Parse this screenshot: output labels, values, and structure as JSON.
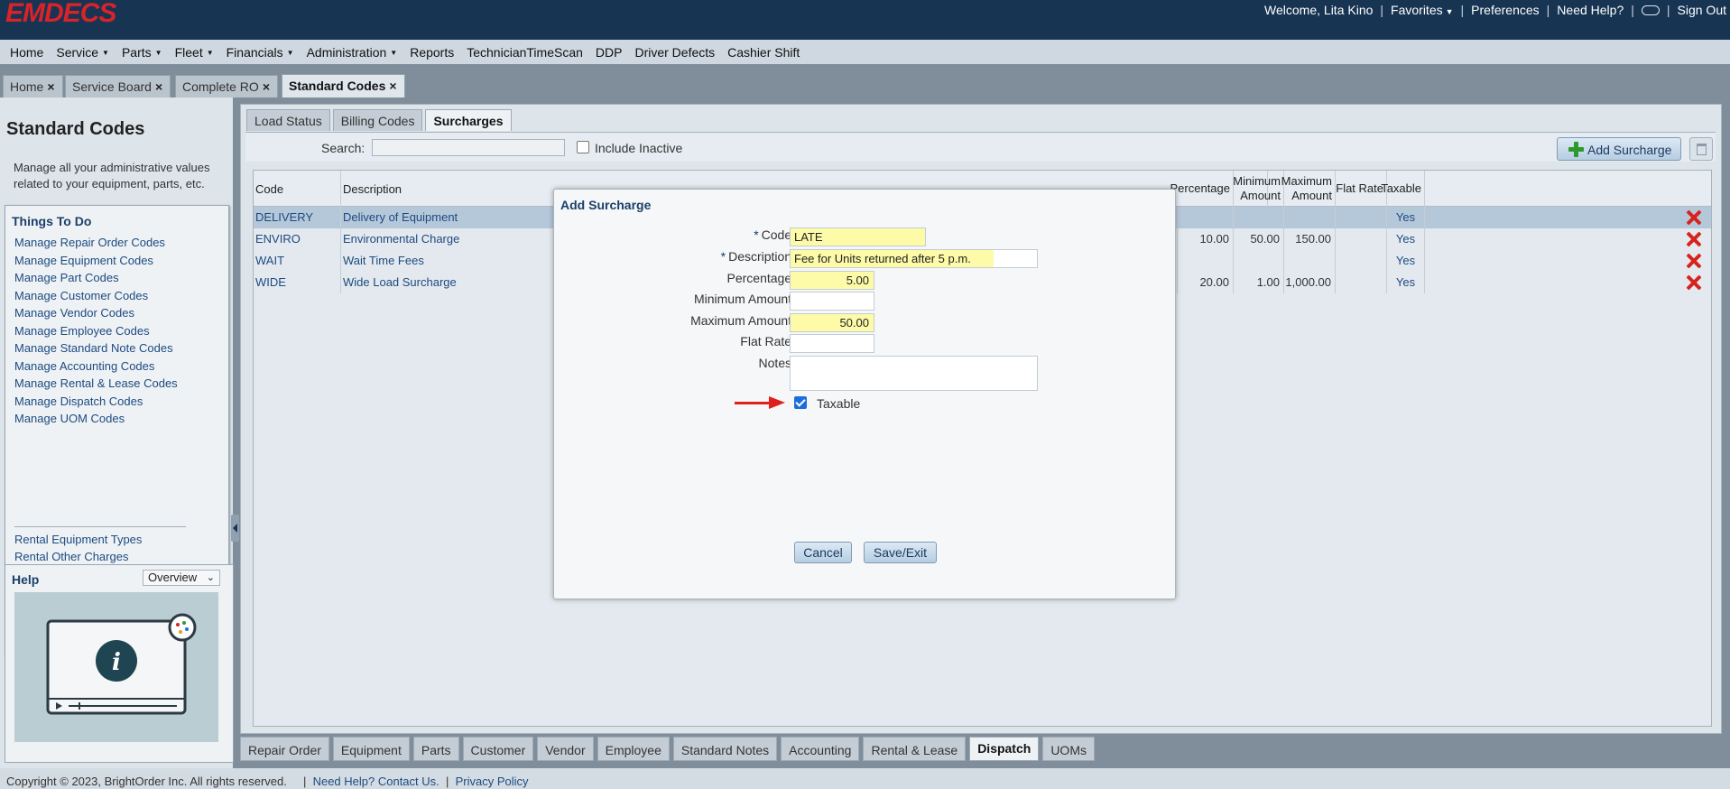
{
  "app": {
    "logo": "EMDECS",
    "welcome": "Welcome, Lita Kino",
    "favorites": "Favorites",
    "preferences": "Preferences",
    "need_help": "Need Help?",
    "sign_out": "Sign Out"
  },
  "menu": {
    "items": [
      {
        "label": "Home",
        "dropdown": false
      },
      {
        "label": "Service",
        "dropdown": true
      },
      {
        "label": "Parts",
        "dropdown": true
      },
      {
        "label": "Fleet",
        "dropdown": true
      },
      {
        "label": "Financials",
        "dropdown": true
      },
      {
        "label": "Administration",
        "dropdown": true
      },
      {
        "label": "Reports",
        "dropdown": false
      },
      {
        "label": "TechnicianTimeScan",
        "dropdown": false
      },
      {
        "label": "DDP",
        "dropdown": false
      },
      {
        "label": "Driver Defects",
        "dropdown": false
      },
      {
        "label": "Cashier Shift",
        "dropdown": false
      }
    ]
  },
  "page_tabs": [
    {
      "label": "Home",
      "active": false
    },
    {
      "label": "Service Board",
      "active": false
    },
    {
      "label": "Complete RO",
      "active": false
    },
    {
      "label": "Standard Codes",
      "active": true
    }
  ],
  "sidebar": {
    "title": "Standard Codes",
    "description": "Manage all your administrative values related to your equipment, parts, etc.",
    "things_to_do_title": "Things To Do",
    "things_to_do": [
      "Manage Repair Order Codes",
      "Manage Equipment Codes",
      "Manage Part Codes",
      "Manage Customer Codes",
      "Manage Vendor Codes",
      "Manage Employee Codes",
      "Manage Standard Note Codes",
      "Manage Accounting Codes",
      "Manage Rental & Lease Codes",
      "Manage Dispatch Codes",
      "Manage UOM Codes"
    ],
    "other_links": [
      "Rental Equipment Types",
      "Rental Other Charges"
    ],
    "help_title": "Help",
    "help_select": "Overview"
  },
  "main": {
    "subtabs": [
      {
        "label": "Load Status",
        "active": false
      },
      {
        "label": "Billing Codes",
        "active": false
      },
      {
        "label": "Surcharges",
        "active": true
      }
    ],
    "search_label": "Search:",
    "search_value": "",
    "include_inactive_label": "Include Inactive",
    "add_button": "Add Surcharge",
    "columns": {
      "code": "Code",
      "description": "Description",
      "percentage": "Percentage",
      "minimum_amount": "Minimum Amount",
      "maximum_amount": "Maximum Amount",
      "flat_rate": "Flat Rate",
      "taxable": "Taxable"
    },
    "rows": [
      {
        "code": "DELIVERY",
        "description": "Delivery of Equipment",
        "percentage": "",
        "minimum": "",
        "maximum": "",
        "flat_rate": "",
        "taxable": "Yes",
        "selected": true
      },
      {
        "code": "ENVIRO",
        "description": "Environmental Charge",
        "percentage": "10.00",
        "minimum": "50.00",
        "maximum": "150.00",
        "flat_rate": "",
        "taxable": "Yes",
        "selected": false
      },
      {
        "code": "WAIT",
        "description": "Wait Time Fees",
        "percentage": "",
        "minimum": "",
        "maximum": "",
        "flat_rate": "",
        "taxable": "Yes",
        "selected": false
      },
      {
        "code": "WIDE",
        "description": "Wide Load Surcharge",
        "percentage": "20.00",
        "minimum": "1.00",
        "maximum": "1,000.00",
        "flat_rate": "",
        "taxable": "Yes",
        "selected": false
      }
    ]
  },
  "bottom_tabs": [
    {
      "label": "Repair Order",
      "active": false
    },
    {
      "label": "Equipment",
      "active": false
    },
    {
      "label": "Parts",
      "active": false
    },
    {
      "label": "Customer",
      "active": false
    },
    {
      "label": "Vendor",
      "active": false
    },
    {
      "label": "Employee",
      "active": false
    },
    {
      "label": "Standard Notes",
      "active": false
    },
    {
      "label": "Accounting",
      "active": false
    },
    {
      "label": "Rental & Lease",
      "active": false
    },
    {
      "label": "Dispatch",
      "active": true
    },
    {
      "label": "UOMs",
      "active": false
    }
  ],
  "footer": {
    "copyright": "Copyright © 2023, BrightOrder Inc. All rights reserved.",
    "contact": "Need Help? Contact Us.",
    "privacy": "Privacy Policy"
  },
  "modal": {
    "title": "Add Surcharge",
    "code_label": "Code:",
    "code_value": "LATE",
    "description_label": "Description:",
    "description_value": "Fee for Units returned after 5 p.m.",
    "percentage_label": "Percentage:",
    "percentage_value": "5.00",
    "minimum_label": "Minimum Amount:",
    "minimum_value": "",
    "maximum_label": "Maximum Amount:",
    "maximum_value": "50.00",
    "flat_rate_label": "Flat Rate:",
    "flat_rate_value": "",
    "notes_label": "Notes:",
    "notes_value": "",
    "taxable_label": "Taxable",
    "taxable_checked": true,
    "cancel_button": "Cancel",
    "save_button": "Save/Exit"
  },
  "colors": {
    "topbar": "#173452",
    "logo": "#d8232a",
    "field_highlight": "#fdfba8",
    "delete": "#d6231e",
    "annotation_arrow": "#e0201a"
  },
  "icons": [
    "caret-down-icon",
    "oval-icon",
    "close-icon",
    "plus-icon",
    "trash-icon",
    "delete-icon",
    "checkbox-icon",
    "arrow-annotation",
    "video-info-icon"
  ]
}
